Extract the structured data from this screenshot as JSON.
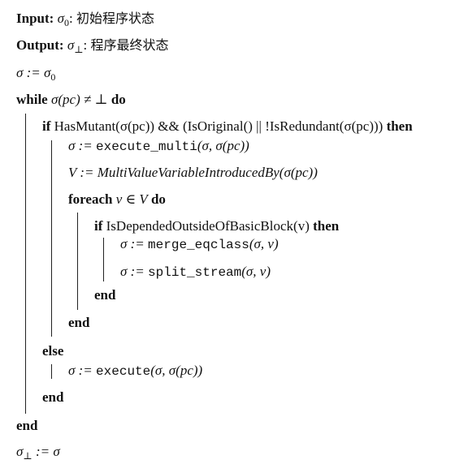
{
  "header": {
    "input_label": "Input:",
    "input_value": "初始程序状态",
    "output_label": "Output:",
    "output_value": "程序最终状态"
  },
  "keywords": {
    "while": "while",
    "do": "do",
    "if": "if",
    "then": "then",
    "foreach": "foreach",
    "end": "end",
    "else": "else"
  },
  "code": {
    "init_assign": "σ := σ",
    "init_sub": "0",
    "while_cond": "σ(pc) ≠ ⊥",
    "if_cond": "HasMutant(σ(pc)) && (IsOriginal() || !IsRedundant(σ(pc)))",
    "exec_multi_lhs": "σ :=",
    "exec_multi_fn": "execute_multi",
    "exec_multi_args": "(σ, σ(pc))",
    "v_assign": "V := MultiValueVariableIntroducedBy(σ(pc))",
    "foreach_var": "v ∈ V",
    "if2_cond": "IsDependedOutsideOfBasicBlock(v)",
    "merge_lhs": "σ :=",
    "merge_fn": "merge_eqclass",
    "merge_args": "(σ, v)",
    "split_lhs": "σ :=",
    "split_fn": "split_stream",
    "split_args": "(σ, v)",
    "exec_lhs": "σ :=",
    "exec_fn": "execute",
    "exec_args": "(σ, σ(pc))",
    "final_assign": "σ",
    "final_sub": "⊥",
    "final_rhs": ":= σ"
  },
  "symbols": {
    "sigma0": "σ",
    "sigma0_sub": "0",
    "sigma_bot": "σ",
    "sigma_bot_sub": "⊥"
  }
}
